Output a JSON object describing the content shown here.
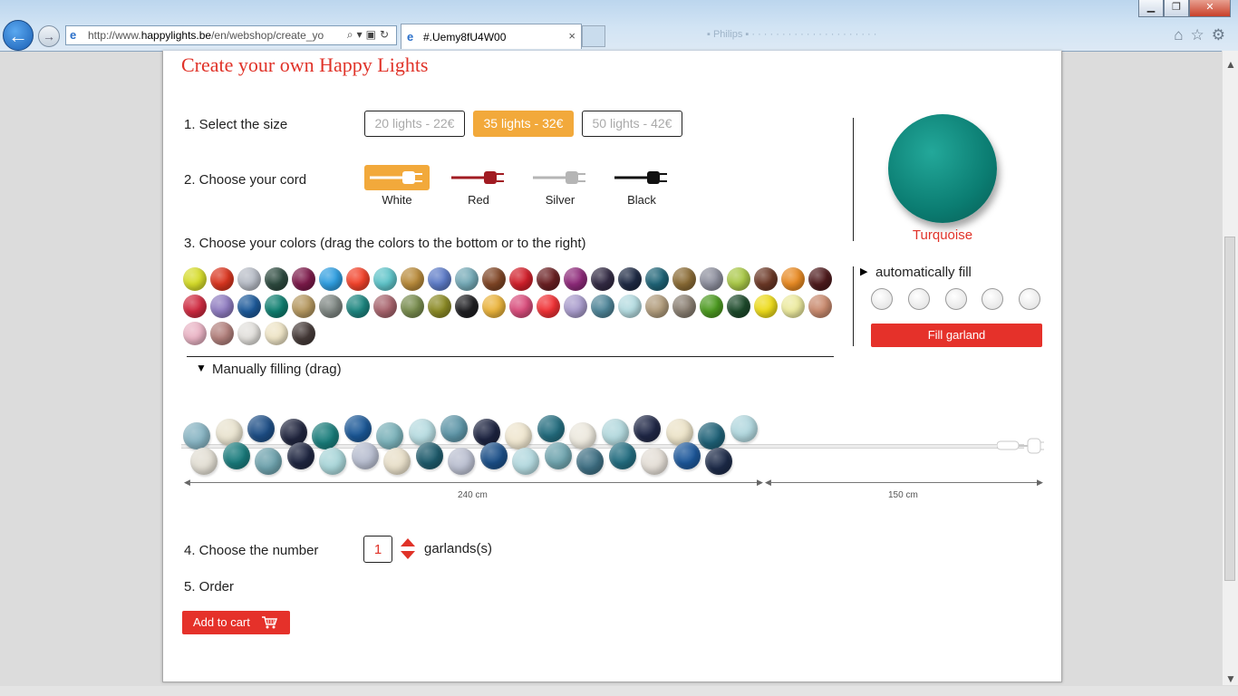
{
  "browser": {
    "url_prefix": "http://www.",
    "url_domain": "happylights.be",
    "url_rest": "/en/webshop/create_yo",
    "tab_title": "#.Uemy8fU4W00",
    "tab_close": "×",
    "back_icon": "←",
    "forward_icon": "→",
    "window_controls": {
      "minimize": "▁",
      "restore": "❐",
      "close": "✕"
    }
  },
  "page": {
    "title": "Create your own Happy Lights",
    "step1": {
      "label": "1. Select the size",
      "options": [
        {
          "label": "20 lights - 22€",
          "selected": false
        },
        {
          "label": "35 lights - 32€",
          "selected": true
        },
        {
          "label": "50 lights - 42€",
          "selected": false
        }
      ]
    },
    "step2": {
      "label": "2. Choose your cord",
      "cords": [
        {
          "label": "White",
          "color": "#ffffff",
          "selected": true
        },
        {
          "label": "Red",
          "color": "#a11b22",
          "selected": false
        },
        {
          "label": "Silver",
          "color": "#b5b5b5",
          "selected": false
        },
        {
          "label": "Black",
          "color": "#111111",
          "selected": false
        }
      ]
    },
    "step3": {
      "label": "3. Choose your colors (drag the colors to the bottom or to the right)",
      "palette": [
        "#d6dc2a",
        "#d9351f",
        "#b7bcc6",
        "#2d4a3f",
        "#7c1a4a",
        "#2f9ee0",
        "#f2422a",
        "#5fc4c9",
        "#b88a3a",
        "#5d7bc7",
        "#75aab7",
        "#7f4525",
        "#d11f2a",
        "#6a1f22",
        "#8e2a7a",
        "#332b44",
        "#1e2a44",
        "#1f6477",
        "#8a6b35",
        "#8d8f9d",
        "#a9c847",
        "#6b3826",
        "#e88a23",
        "#4e1a1c",
        "#cf2a40",
        "#8f7cc0",
        "#1d5a9a",
        "#0f7f70",
        "#b59860",
        "#7f8783",
        "#1d8680",
        "#a8646d",
        "#788c4e",
        "#8b8a25",
        "#1f1f22",
        "#eab33c",
        "#d94d7c",
        "#f03135",
        "#a99ccc",
        "#4f8598",
        "#b4dbe0",
        "#b19c7c",
        "#8a7f72",
        "#4c9a20",
        "#1d4a2b",
        "#eddb1b",
        "#ecea9e",
        "#c98a6e",
        "#e9b3c4",
        "#b2807c",
        "#e2e0dc",
        "#eee4c6",
        "#463b39"
      ],
      "manual_label": "Manually filling (drag)",
      "dimension_left": "240 cm",
      "dimension_right": "150 cm",
      "garland_balls": [
        "#86b3c2",
        "#e9e3cf",
        "#1d4e86",
        "#20253e",
        "#187c7a",
        "#1a5796",
        "#7ab1b9",
        "#b6dbe0",
        "#5d95a7",
        "#1c2340",
        "#efe6cf",
        "#236c7e",
        "#ece8dd",
        "#b2d8dd",
        "#1f2746",
        "#ece3c8",
        "#1e6177",
        "#b1d7de",
        "#e2ded3",
        "#197b7c",
        "#6ea2ad",
        "#1f2641",
        "#a8d5d8",
        "#b7bdcf",
        "#e8dfc9",
        "#1e5b6c",
        "#babfd0",
        "#1b4f88",
        "#b2d8de",
        "#70a5af",
        "#3e6f83",
        "#236d80",
        "#e4ded6",
        "#1c579a",
        "#1c2a48"
      ]
    },
    "preview": {
      "name": "Turquoise",
      "color": "#0f8a7d"
    },
    "auto_fill": {
      "label": "automatically fill",
      "slot_count": 5,
      "button": "Fill garland"
    },
    "step4": {
      "label": "4. Choose the number",
      "quantity": "1",
      "unit": "garlands(s)"
    },
    "step5": {
      "label": "5. Order",
      "button": "Add to cart"
    }
  }
}
